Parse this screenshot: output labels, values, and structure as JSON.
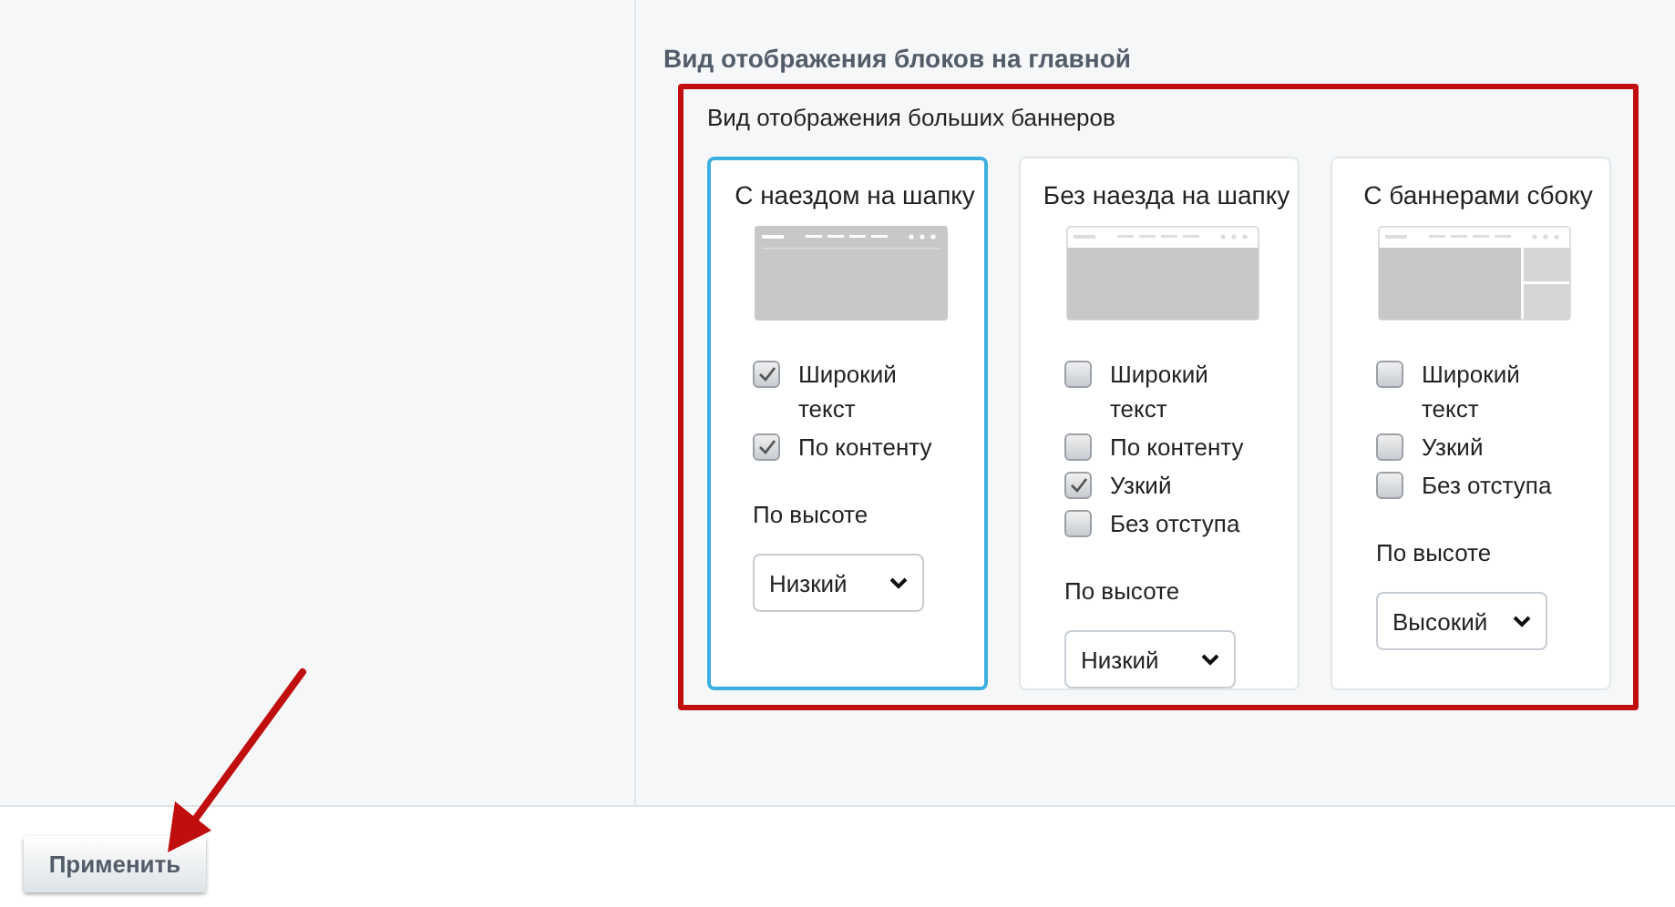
{
  "section_title": "Вид отображения блоков на главной",
  "group": {
    "title": "Вид отображения больших баннеров",
    "options": [
      {
        "title": "С наездом на шапку",
        "kind": "overlay",
        "selected": true,
        "checkboxes": [
          {
            "label": "Широкий текст",
            "checked": true
          },
          {
            "label": "По контенту",
            "checked": true
          }
        ],
        "height_label": "По высоте",
        "height_value": "Низкий"
      },
      {
        "title": "Без наезда на шапку",
        "kind": "below",
        "selected": false,
        "checkboxes": [
          {
            "label": "Широкий текст",
            "checked": false
          },
          {
            "label": "По контенту",
            "checked": false
          },
          {
            "label": "Узкий",
            "checked": true
          },
          {
            "label": "Без отступа",
            "checked": false
          }
        ],
        "height_label": "По высоте",
        "height_value": "Низкий"
      },
      {
        "title": "С баннерами сбоку",
        "kind": "side",
        "selected": false,
        "checkboxes": [
          {
            "label": "Широкий текст",
            "checked": false
          },
          {
            "label": "Узкий",
            "checked": false
          },
          {
            "label": "Без отступа",
            "checked": false
          }
        ],
        "height_label": "По высоте",
        "height_value": "Высокий"
      }
    ]
  },
  "apply_button": "Применить"
}
